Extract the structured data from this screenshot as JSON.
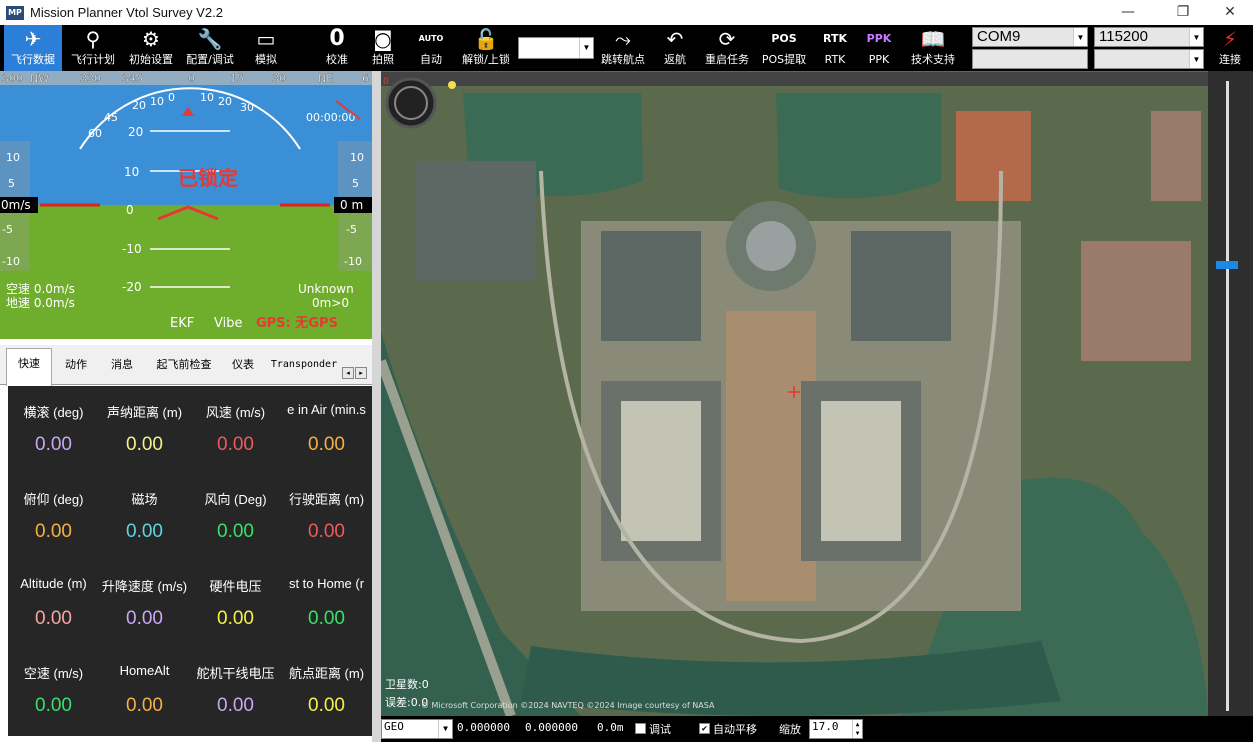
{
  "window": {
    "title": "Mission Planner Vtol Survey V2.2",
    "icon_text": "MP",
    "controls": [
      "—",
      "❐",
      "✕"
    ]
  },
  "toolbar": {
    "buttons": [
      {
        "label": "飞行数据",
        "icon": "plane-icon"
      },
      {
        "label": "飞行计划",
        "icon": "map-pin-icon"
      },
      {
        "label": "初始设置",
        "icon": "gear-icon"
      },
      {
        "label": "配置/调试",
        "icon": "wrench-icon"
      },
      {
        "label": "模拟",
        "icon": "monitor-icon"
      },
      {
        "label": "校准",
        "icon": "zero-icon"
      },
      {
        "label": "拍照",
        "icon": "camera-icon"
      },
      {
        "label": "自动",
        "icon": "auto-icon"
      },
      {
        "label": "解锁/上锁",
        "icon": "lock-icon"
      },
      {
        "label": "跳转航点",
        "icon": "jump-waypoint-icon"
      },
      {
        "label": "返航",
        "icon": "return-home-icon"
      },
      {
        "label": "重启任务",
        "icon": "restart-icon"
      },
      {
        "label": "POS提取",
        "icon": "pos-icon"
      },
      {
        "label": "RTK",
        "icon": "rtk-icon"
      },
      {
        "label": "PPK",
        "icon": "ppk-icon"
      },
      {
        "label": "技术支持",
        "icon": "support-book-icon"
      }
    ],
    "icon_text": {
      "zero": "0",
      "auto": "AUTO",
      "pos": "POS",
      "rtk": "RTK",
      "ppk": "PPK"
    },
    "mode_select": "",
    "port": "COM9",
    "baud": "115200",
    "connect_label": "连接"
  },
  "hud": {
    "heading_labels": [
      "300",
      "NW",
      "330",
      "345",
      "0",
      "15",
      "30",
      "NE",
      "6"
    ],
    "status_text": "已锁定",
    "left_scale": [
      "10",
      "5",
      "0m/s",
      "-5",
      "-10"
    ],
    "right_scale": [
      "10",
      "5",
      "0 m",
      "-5",
      "-10"
    ],
    "pitch_labels": [
      "20",
      "10",
      "0",
      "-10",
      "-20"
    ],
    "roll_labels": [
      "20",
      "10",
      "0",
      "10",
      "20",
      "30",
      "45",
      "60",
      "30",
      "20",
      "45",
      "60"
    ],
    "airspeed": "空速 0.0m/s",
    "groundspeed": "地速 0.0m/s",
    "timer": "00:00:00",
    "mode_unknown": "Unknown",
    "dist": "0m>0",
    "ekf": "EKF",
    "vibe": "Vibe",
    "gps": "GPS: 无GPS",
    "colors": {
      "sky": "#3b8fd6",
      "ground": "#6fae2c",
      "status": "#e53935",
      "text": "#ffffff"
    }
  },
  "tabs": {
    "items": [
      "快速",
      "动作",
      "消息",
      "起飞前检查",
      "仪表",
      "Transponder"
    ],
    "scroll_left": "◂",
    "scroll_right": "▸"
  },
  "quick": {
    "cells": [
      {
        "label": "横滚 (deg)",
        "value": "0.00",
        "color": "#c9a7f5"
      },
      {
        "label": "声纳距离 (m)",
        "value": "0.00",
        "color": "#f4f08a"
      },
      {
        "label": "风速 (m/s)",
        "value": "0.00",
        "color": "#ef5b5b"
      },
      {
        "label": "e in Air (min.s",
        "value": "0.00",
        "color": "#f5b041"
      },
      {
        "label": "俯仰 (deg)",
        "value": "0.00",
        "color": "#f5b041"
      },
      {
        "label": "磁场",
        "value": "0.00",
        "color": "#5fd3e0"
      },
      {
        "label": "风向 (Deg)",
        "value": "0.00",
        "color": "#37e06b"
      },
      {
        "label": "行驶距离 (m)",
        "value": "0.00",
        "color": "#ef5b5b"
      },
      {
        "label": "Altitude (m)",
        "value": "0.00",
        "color": "#f7a4a4"
      },
      {
        "label": "升降速度 (m/s)",
        "value": "0.00",
        "color": "#c9a7f5"
      },
      {
        "label": "硬件电压",
        "value": "0.00",
        "color": "#f4f04a"
      },
      {
        "label": "st to Home (r",
        "value": "0.00",
        "color": "#37e06b"
      },
      {
        "label": "空速 (m/s)",
        "value": "0.00",
        "color": "#37e06b"
      },
      {
        "label": "HomeAlt",
        "value": "0.00",
        "color": "#f5b041"
      },
      {
        "label": "舵机干线电压",
        "value": "0.00",
        "color": "#c9a7f5"
      },
      {
        "label": "航点距离 (m)",
        "value": "0.00",
        "color": "#f4f04a"
      }
    ]
  },
  "map": {
    "sat_count": "卫星数:0",
    "hdop": "误差:0.0",
    "attribution": "© Microsoft Corporation  ©2024 NAVTEQ  ©2024 Image courtesy of NASA",
    "top_marker": "0"
  },
  "bottom": {
    "coord_system": "GEO",
    "lat": "0.000000",
    "lng": "0.000000",
    "alt": "0.0m",
    "debug_label": "调试",
    "autopan_label": "自动平移",
    "zoom_label": "缩放",
    "zoom_value": "17.0"
  }
}
